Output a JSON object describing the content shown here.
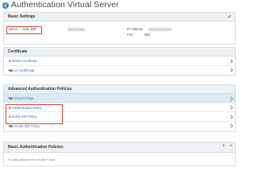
{
  "page": {
    "title": "Authentication Virtual Server"
  },
  "basic_settings": {
    "title": "Basic Settings",
    "name_label": "Name",
    "name_value": "AAA_IDP",
    "ip_label": "IP Address",
    "port_label": "Port",
    "port_value": "443"
  },
  "certificate": {
    "title": "Certificate",
    "rows": [
      {
        "count": "1",
        "label": "Server Certificate"
      },
      {
        "count": "No",
        "label": "CA Certificate"
      }
    ]
  },
  "advanced_policies": {
    "title": "Advanced Authentication Policies",
    "rows": [
      {
        "count": "No",
        "label": "nFactor Flow"
      },
      {
        "count": "1",
        "label": "Authentication Policy"
      },
      {
        "count": "1",
        "label": "SAML IDP Policy"
      },
      {
        "count": "No",
        "label": "OAuth IDP Policy"
      }
    ]
  },
  "basic_policies": {
    "title": "Basic Authentication Policies",
    "add_label": "+",
    "close_label": "×",
    "hint": "To add, please click on the + icon"
  },
  "colors": {
    "accent": "#3a7bbd",
    "highlight": "#dce9f5",
    "annotation": "#d1412f"
  }
}
